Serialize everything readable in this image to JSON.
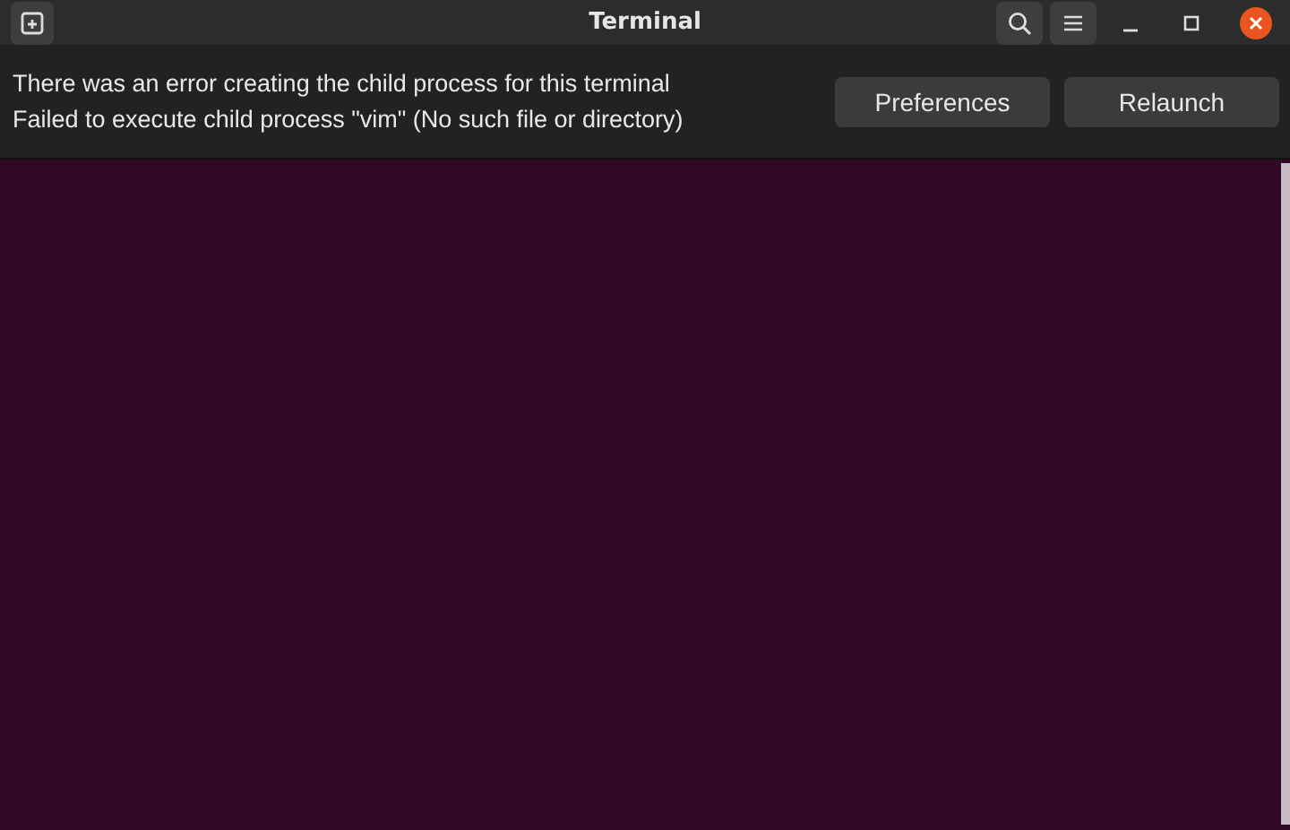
{
  "window": {
    "title": "Terminal"
  },
  "infobar": {
    "messages": [
      "There was an error creating the child process for this terminal",
      "Failed to execute child process \"vim\" (No such file or directory)"
    ],
    "buttons": [
      "Preferences",
      "Relaunch"
    ]
  }
}
